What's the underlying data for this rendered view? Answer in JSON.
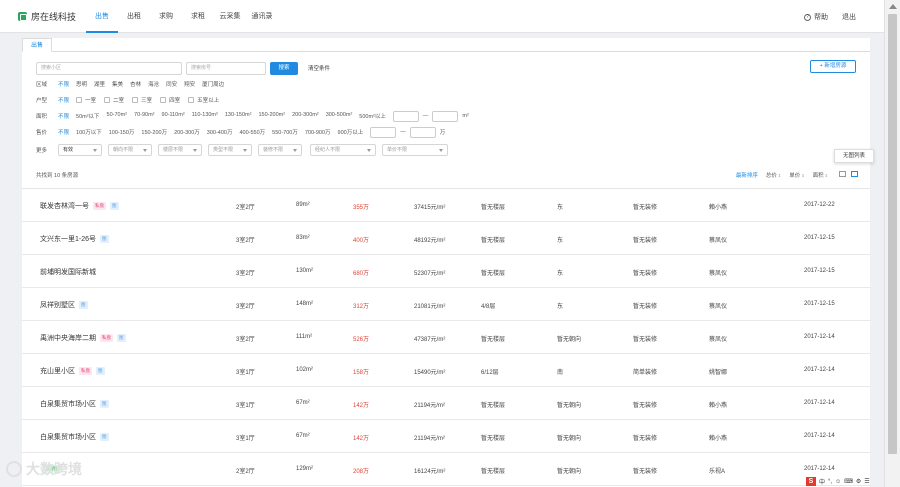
{
  "app": {
    "name": "房在线科技"
  },
  "nav": {
    "tabs": [
      "出售",
      "出租",
      "求购",
      "求租",
      "云采集",
      "通讯录"
    ],
    "active": 0,
    "help": "帮助",
    "logout": "退出"
  },
  "subtab": "出售",
  "search": {
    "community_placeholder": "搜索小区",
    "house_no_placeholder": "搜索房号",
    "button": "搜索",
    "clear": "清空条件",
    "new": "+ 新增房源"
  },
  "filters": {
    "district": {
      "label": "区域",
      "options": [
        "不限",
        "思明",
        "湖里",
        "集美",
        "杏林",
        "海沧",
        "同安",
        "翔安",
        "厦门周边"
      ]
    },
    "layout": {
      "label": "户型",
      "unlimited": "不限",
      "options": [
        "一室",
        "二室",
        "三室",
        "四室",
        "五室以上"
      ]
    },
    "area": {
      "label": "面积",
      "options": [
        "不限",
        "50m²以下",
        "50-70m²",
        "70-90m²",
        "90-110m²",
        "110-130m²",
        "130-150m²",
        "150-200m²",
        "200-300m²",
        "300-500m²",
        "500m²以上"
      ],
      "unit": "m²"
    },
    "price": {
      "label": "售价",
      "options": [
        "不限",
        "100万以下",
        "100-150万",
        "150-200万",
        "200-300万",
        "300-400万",
        "400-550万",
        "550-700万",
        "700-900万",
        "900万以上"
      ],
      "unit": "万"
    },
    "more": {
      "label": "更多",
      "selects": [
        "有效",
        "朝向不限",
        "楼层不限",
        "类型不限",
        "装修不限",
        "经纪人不限",
        "单价不限"
      ]
    }
  },
  "tooltip": "无图列表",
  "list": {
    "total": "共找到 10 条房源",
    "sorts": [
      "最新排序",
      "总价",
      "单价",
      "面积"
    ]
  },
  "rows": [
    {
      "name": "联发杏林湾一号",
      "tags": [
        {
          "t": "私盘",
          "c": "pink"
        },
        {
          "t": "图",
          "c": "blue"
        }
      ],
      "layout": "2室2厅",
      "area": "89m²",
      "price": "355万",
      "unit": "37415元/m²",
      "floor": "暂无楼层",
      "facing": "东",
      "deco": "暂无装修",
      "agent": "賴小燕",
      "date": "2017-12-22"
    },
    {
      "name": "文兴东一里1-26号",
      "tags": [
        {
          "t": "图",
          "c": "blue"
        }
      ],
      "layout": "3室2厅",
      "area": "83m²",
      "price": "400万",
      "unit": "48192元/m²",
      "floor": "暂无楼层",
      "facing": "东",
      "deco": "暂无装修",
      "agent": "蔡凤仪",
      "date": "2017-12-15"
    },
    {
      "name": "前埔明发国际新城",
      "tags": [],
      "layout": "3室2厅",
      "area": "130m²",
      "price": "680万",
      "unit": "52307元/m²",
      "floor": "暂无楼层",
      "facing": "东",
      "deco": "暂无装修",
      "agent": "蔡凤仪",
      "date": "2017-12-15"
    },
    {
      "name": "凤祥别墅区",
      "tags": [
        {
          "t": "图",
          "c": "blue"
        }
      ],
      "layout": "3室2厅",
      "area": "148m²",
      "price": "312万",
      "unit": "21081元/m²",
      "floor": "4/8层",
      "facing": "东",
      "deco": "暂无装修",
      "agent": "蔡凤仪",
      "date": "2017-12-15"
    },
    {
      "name": "禹洲中央海岸二期",
      "tags": [
        {
          "t": "私盘",
          "c": "pink"
        },
        {
          "t": "图",
          "c": "blue"
        }
      ],
      "layout": "3室2厅",
      "area": "111m²",
      "price": "526万",
      "unit": "47387元/m²",
      "floor": "暂无楼层",
      "facing": "暂无朝向",
      "deco": "暂无装修",
      "agent": "蔡凤仪",
      "date": "2017-12-14"
    },
    {
      "name": "充山里小区",
      "tags": [
        {
          "t": "私盘",
          "c": "pink"
        },
        {
          "t": "图",
          "c": "blue"
        }
      ],
      "layout": "3室1厅",
      "area": "102m²",
      "price": "158万",
      "unit": "15490元/m²",
      "floor": "6/12层",
      "facing": "南",
      "deco": "简单装修",
      "agent": "姚智娜",
      "date": "2017-12-14"
    },
    {
      "name": "白泉集贸市场小区",
      "tags": [
        {
          "t": "图",
          "c": "blue"
        }
      ],
      "layout": "3室1厅",
      "area": "67m²",
      "price": "142万",
      "unit": "21194元/m²",
      "floor": "暂无楼层",
      "facing": "暂无朝向",
      "deco": "暂无装修",
      "agent": "賴小燕",
      "date": "2017-12-14"
    },
    {
      "name": "白泉集贸市场小区",
      "tags": [
        {
          "t": "图",
          "c": "blue"
        }
      ],
      "layout": "3室1厅",
      "area": "67m²",
      "price": "142万",
      "unit": "21194元/m²",
      "floor": "暂无楼层",
      "facing": "暂无朝向",
      "deco": "暂无装修",
      "agent": "賴小燕",
      "date": "2017-12-14"
    },
    {
      "name": "",
      "tags": [
        {
          "t": "有钥匙",
          "c": "green"
        }
      ],
      "layout": "2室2厅",
      "area": "129m²",
      "price": "208万",
      "unit": "16124元/m²",
      "floor": "暂无楼层",
      "facing": "暂无朝向",
      "deco": "暂无装修",
      "agent": "乐视A",
      "date": "2017-12-14"
    }
  ],
  "watermark": "大数跨境",
  "tray": {
    "ime": "S",
    "items": [
      "中",
      "°,",
      "☺",
      "⌨",
      "⚙",
      "☰"
    ]
  }
}
